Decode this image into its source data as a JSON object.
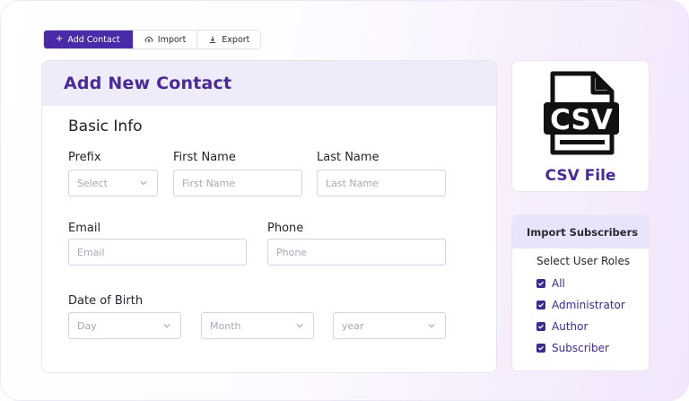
{
  "toolbar": {
    "add_label": "Add Contact",
    "import_label": "Import",
    "export_label": "Export"
  },
  "form": {
    "title": "Add New Contact",
    "section": "Basic Info",
    "prefix": {
      "label": "Prefix",
      "placeholder": "Select"
    },
    "first_name": {
      "label": "First Name",
      "placeholder": "First Name"
    },
    "last_name": {
      "label": "Last Name",
      "placeholder": "Last Name"
    },
    "email": {
      "label": "Email",
      "placeholder": "Email"
    },
    "phone": {
      "label": "Phone",
      "placeholder": "Phone"
    },
    "dob": {
      "label": "Date of Birth",
      "day": "Day",
      "month": "Month",
      "year": "year"
    }
  },
  "csv": {
    "icon_text": "CSV",
    "label": "CSV File"
  },
  "import": {
    "title": "Import Subscribers",
    "subtitle": "Select User Roles",
    "roles": [
      "All",
      "Administrator",
      "Author",
      "Subscriber"
    ]
  },
  "colors": {
    "primary": "#4a2aa8",
    "accent_text": "#4a2a98",
    "header_bg": "#eeebfb",
    "checkbox": "#3d2a8c"
  }
}
